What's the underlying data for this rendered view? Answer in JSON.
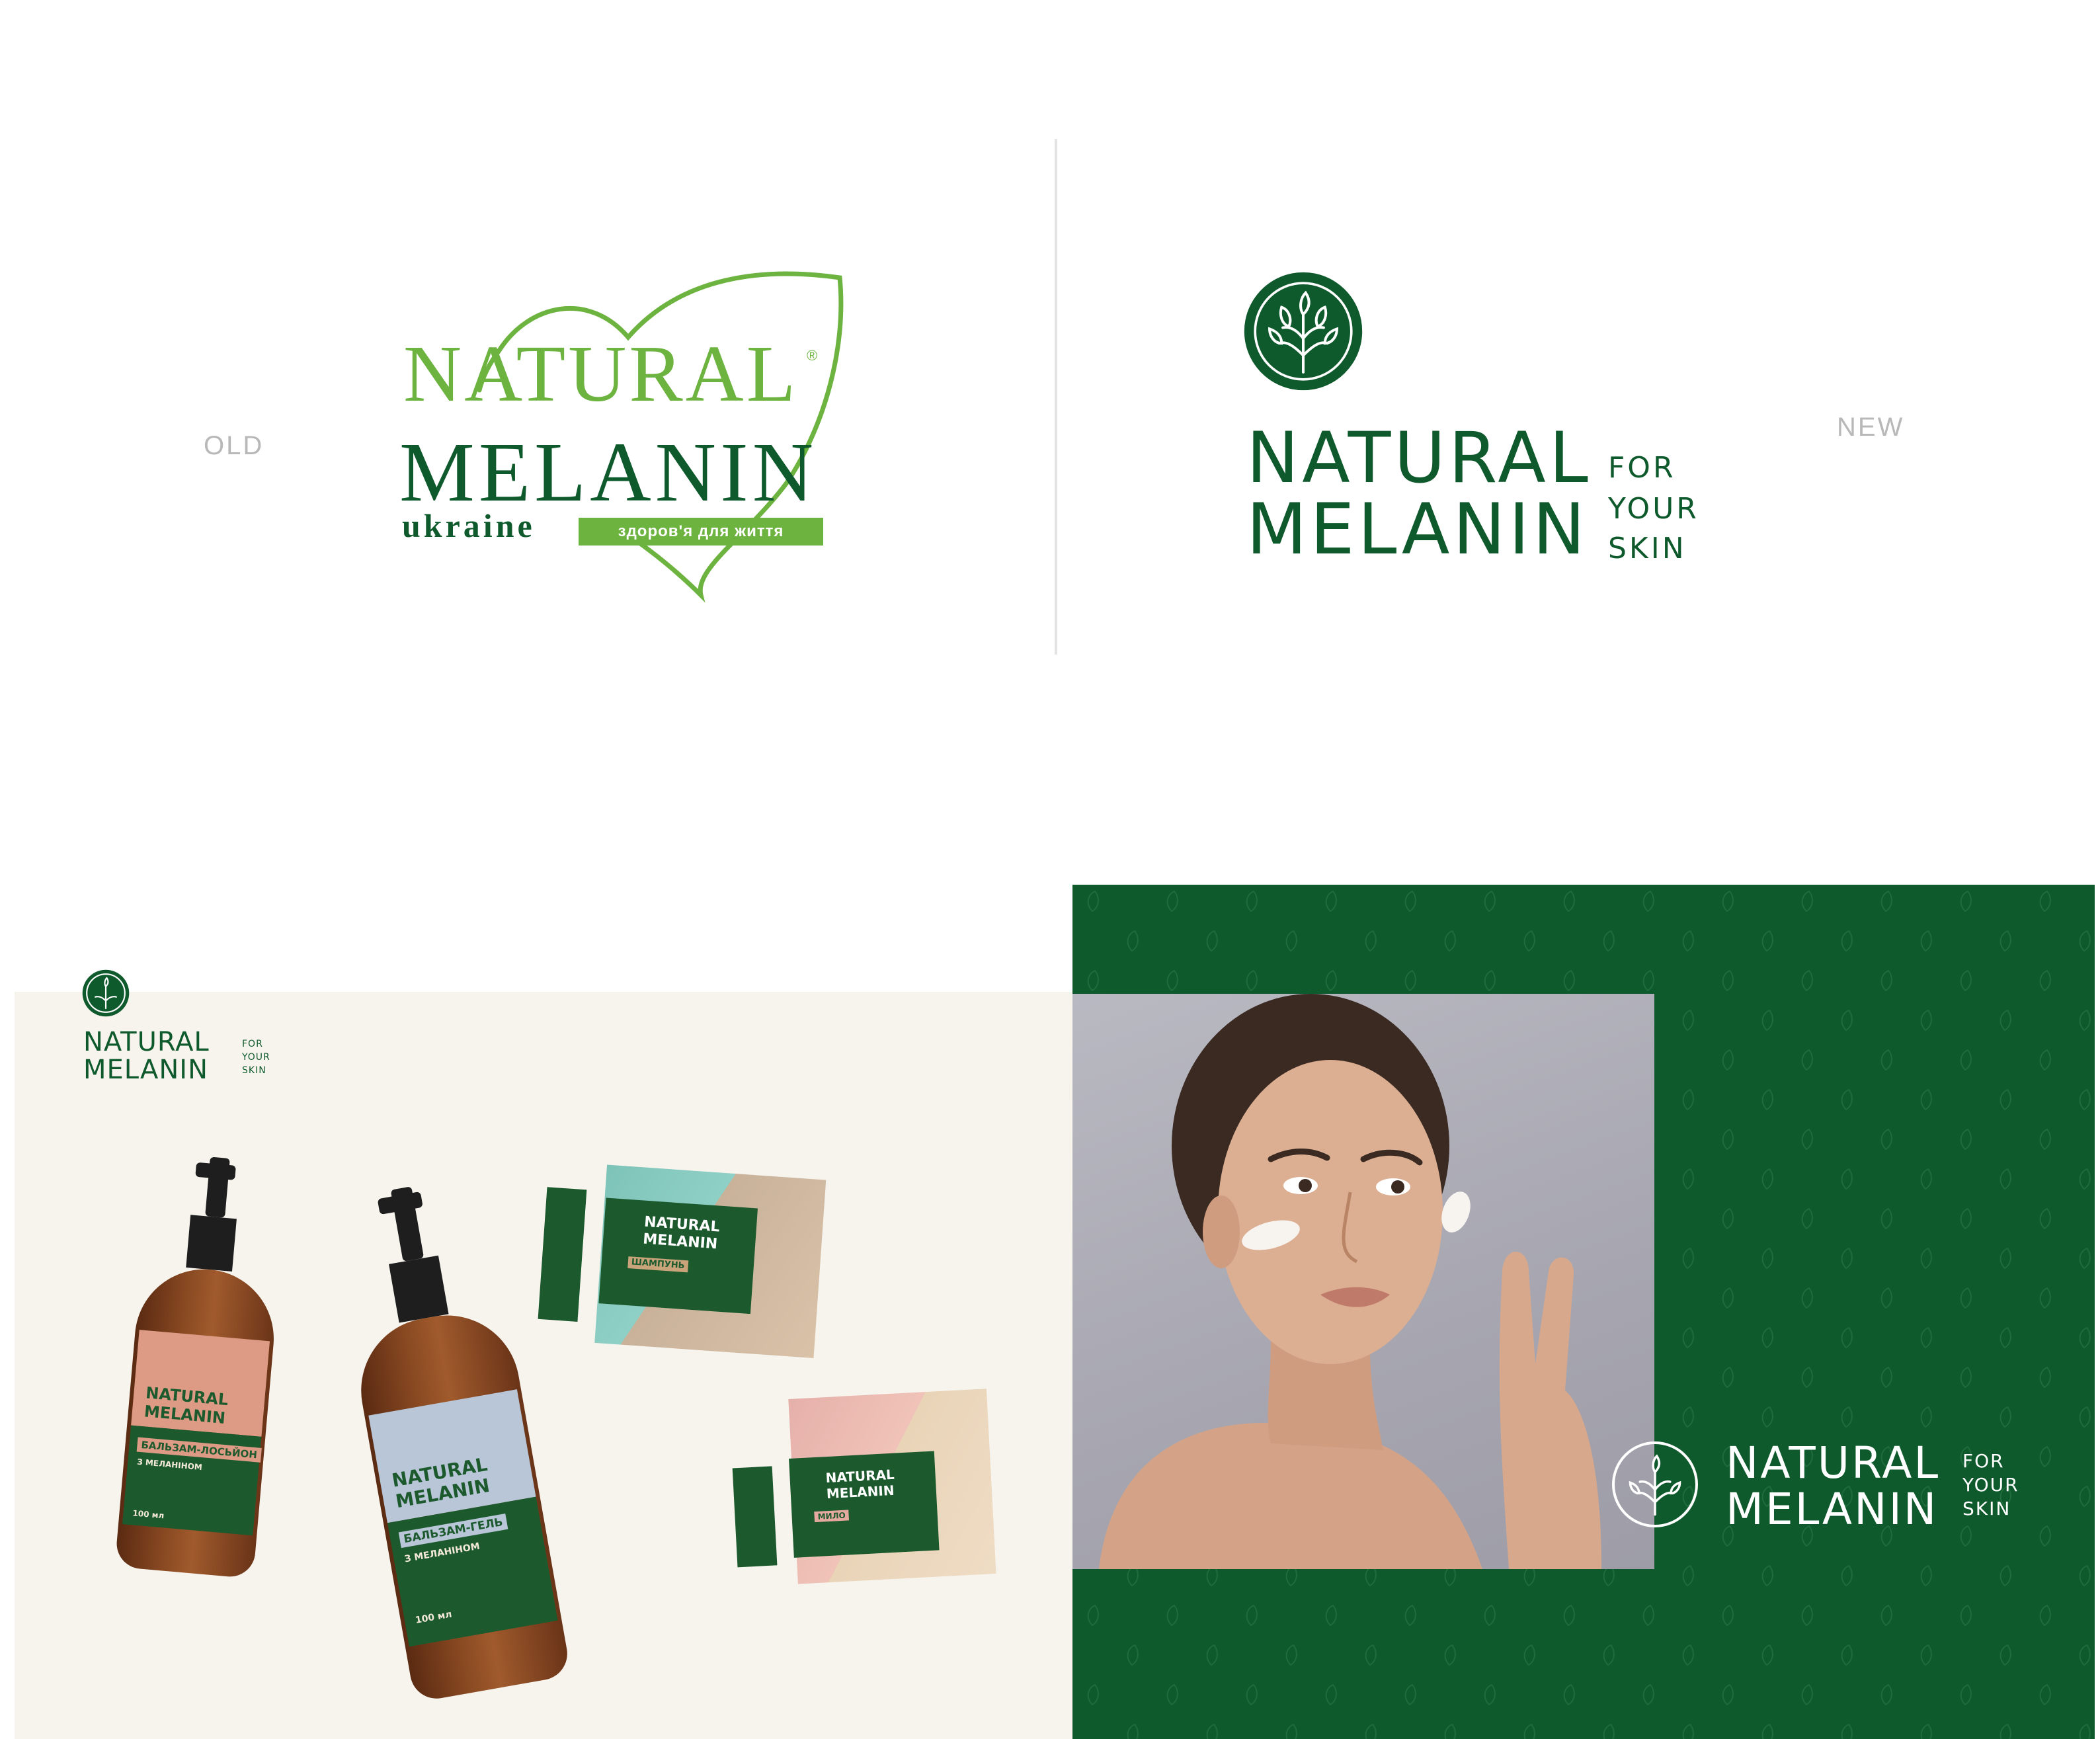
{
  "comparison": {
    "old_label": "OLD",
    "new_label": "NEW"
  },
  "old_logo": {
    "natural": "NATURAL",
    "registered": "®",
    "melanin": "MELANIN",
    "ukraine": "ukraine",
    "tagline": "здоров'я для життя",
    "colors": {
      "light_green": "#6cb33f",
      "dark_green": "#0f5a2c"
    }
  },
  "new_logo": {
    "natural": "NATURAL",
    "melanin": "MELANIN",
    "for": "FOR",
    "your": "YOUR",
    "skin": "SKIN",
    "emblem_icon": "leaf-branch-emblem-icon",
    "color": "#0f5a2c"
  },
  "packaging_panel": {
    "logo": {
      "natural": "NATURAL",
      "melanin": "MELANIN",
      "for": "FOR",
      "your": "YOUR",
      "skin": "SKIN"
    },
    "bottle_1": {
      "natural": "NATURAL",
      "melanin": "MELANIN",
      "product": "БАЛЬЗАМ-ЛОСЬЙОН",
      "sub": "З МЕЛАНІНОМ",
      "volume": "100 мл"
    },
    "bottle_2": {
      "natural": "NATURAL",
      "melanin": "MELANIN",
      "product": "БАЛЬЗАМ-ГЕЛЬ",
      "sub": "З МЕЛАНІНОМ",
      "volume": "100 мл"
    },
    "box_1": {
      "natural": "NATURAL",
      "melanin": "MELANIN",
      "product": "ШАМПУНЬ"
    },
    "box_2": {
      "natural": "NATURAL",
      "melanin": "MELANIN",
      "product": "МИЛО"
    },
    "colors": {
      "cream": "#f7f4ee",
      "label_green": "#1c5a2e",
      "peach": "#dd9a84",
      "blue_grey": "#b8c6d8"
    }
  },
  "campaign_panel": {
    "natural": "NATURAL",
    "melanin": "MELANIN",
    "for": "FOR",
    "your": "YOUR",
    "skin": "SKIN",
    "background_color": "#0f5a2c"
  }
}
